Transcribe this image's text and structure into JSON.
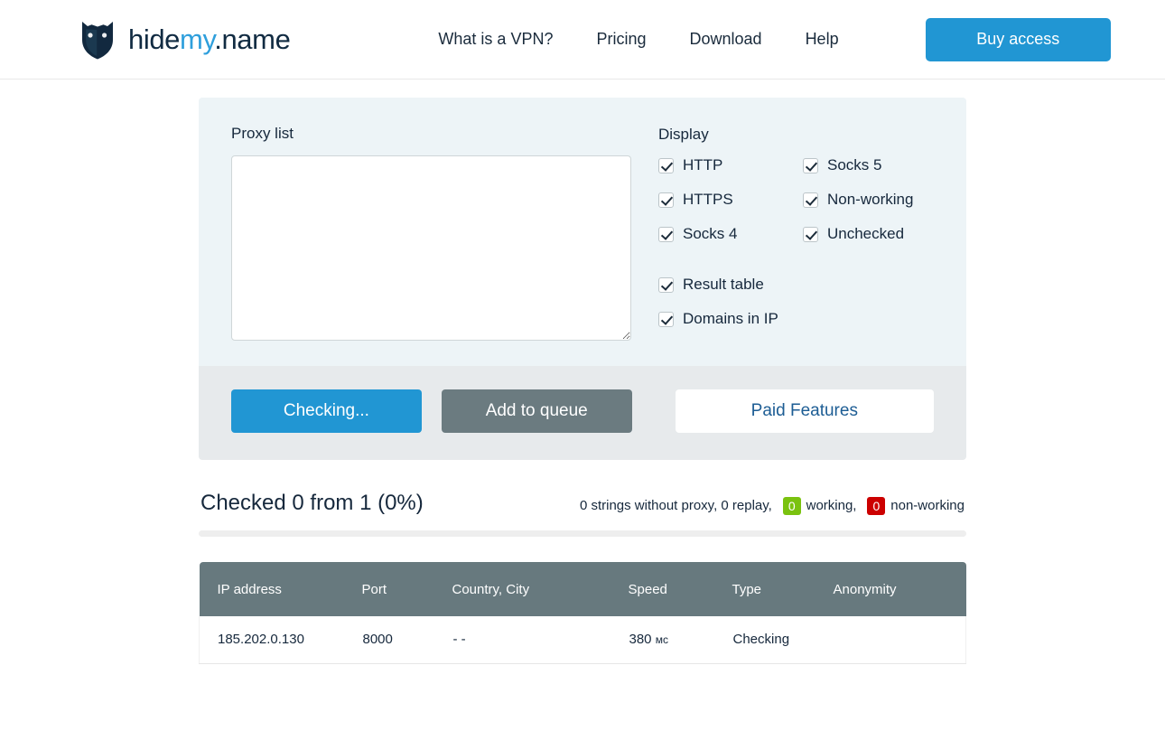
{
  "header": {
    "logo": {
      "icon": "shield-cat-logo-icon",
      "text_dark_1": "hide",
      "text_blue": "my",
      "text_dark_2": ".name"
    },
    "nav": [
      {
        "label": "What is a VPN?"
      },
      {
        "label": "Pricing"
      },
      {
        "label": "Download"
      },
      {
        "label": "Help"
      }
    ],
    "buy_button": "Buy access"
  },
  "tool": {
    "proxy_list_label": "Proxy list",
    "proxy_list_value": "",
    "proxy_list_placeholder": "",
    "display_label": "Display",
    "checkboxes_grid": [
      {
        "label": "HTTP",
        "checked": true
      },
      {
        "label": "Socks 5",
        "checked": true
      },
      {
        "label": "HTTPS",
        "checked": true
      },
      {
        "label": "Non-working",
        "checked": true
      },
      {
        "label": "Socks 4",
        "checked": true
      },
      {
        "label": "Unchecked",
        "checked": true
      }
    ],
    "checkboxes_single": [
      {
        "label": "Result table",
        "checked": true
      },
      {
        "label": "Domains in IP",
        "checked": true
      }
    ],
    "buttons": {
      "check": "Checking...",
      "queue": "Add to queue",
      "paid": "Paid Features"
    }
  },
  "status": {
    "checked_title": "Checked 0 from 1 (0%)",
    "summary_prefix": "0 strings without proxy, 0 replay,",
    "working_count": "0",
    "working_label": "working,",
    "nonworking_count": "0",
    "nonworking_label": "non-working",
    "progress_percent": 0
  },
  "table": {
    "columns": [
      "IP address",
      "Port",
      "Country, City",
      "Speed",
      "Type",
      "Anonymity"
    ],
    "rows": [
      {
        "ip": "185.202.0.130",
        "port": "8000",
        "location": "- -",
        "speed_value": "380",
        "speed_unit": "мс",
        "type": "Checking",
        "anonymity": ""
      }
    ]
  },
  "colors": {
    "accent_blue": "#2196d3",
    "panel_blue": "#edf4f7",
    "panel_gray": "#e7eaec",
    "table_header": "#67797e",
    "badge_green": "#7ac20f",
    "badge_red": "#cc0000",
    "text_dark": "#16283c"
  }
}
